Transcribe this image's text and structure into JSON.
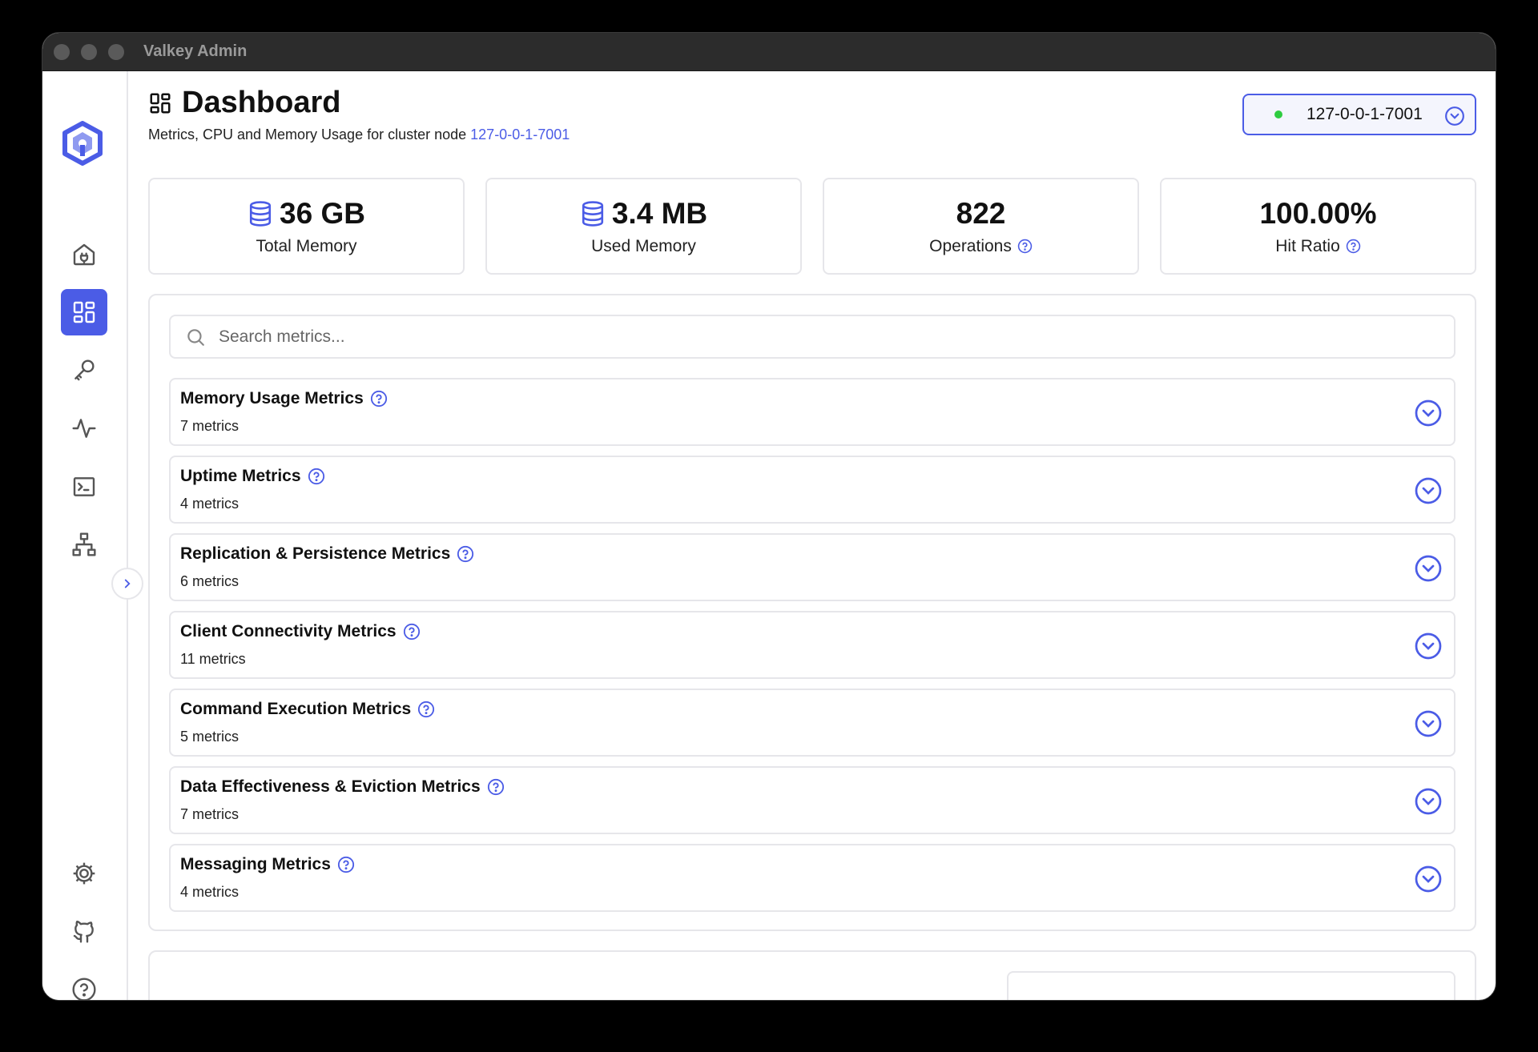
{
  "window": {
    "title": "Valkey Admin"
  },
  "sidebar": {
    "items": [
      {
        "name": "connections",
        "icon": "home-plug-icon"
      },
      {
        "name": "dashboard",
        "icon": "dashboard-icon",
        "active": true
      },
      {
        "name": "keys",
        "icon": "key-icon"
      },
      {
        "name": "monitoring",
        "icon": "activity-icon"
      },
      {
        "name": "terminal",
        "icon": "terminal-icon"
      },
      {
        "name": "cluster",
        "icon": "network-icon"
      }
    ],
    "bottom_items": [
      {
        "name": "settings",
        "icon": "gear-icon"
      },
      {
        "name": "github",
        "icon": "github-icon"
      },
      {
        "name": "help",
        "icon": "help-icon"
      }
    ]
  },
  "header": {
    "title": "Dashboard",
    "subtitle_prefix": "Metrics, CPU and Memory Usage for cluster node ",
    "node_link": "127-0-0-1-7001"
  },
  "node_selector": {
    "value": "127-0-0-1-7001",
    "status_color": "#2ecc40"
  },
  "stats": [
    {
      "value": "36 GB",
      "label": "Total Memory",
      "icon": "database-icon"
    },
    {
      "value": "3.4 MB",
      "label": "Used Memory",
      "icon": "database-icon"
    },
    {
      "value": "822",
      "label": "Operations",
      "help": true
    },
    {
      "value": "100.00%",
      "label": "Hit Ratio",
      "help": true
    }
  ],
  "search": {
    "placeholder": "Search metrics..."
  },
  "metric_groups": [
    {
      "title": "Memory Usage Metrics",
      "count": "7 metrics"
    },
    {
      "title": "Uptime Metrics",
      "count": "4 metrics"
    },
    {
      "title": "Replication & Persistence Metrics",
      "count": "6 metrics"
    },
    {
      "title": "Client Connectivity Metrics",
      "count": "11 metrics"
    },
    {
      "title": "Command Execution Metrics",
      "count": "5 metrics"
    },
    {
      "title": "Data Effectiveness & Eviction Metrics",
      "count": "7 metrics"
    },
    {
      "title": "Messaging Metrics",
      "count": "4 metrics"
    }
  ],
  "colors": {
    "accent": "#4b5ce6",
    "border": "#e6e6ea"
  }
}
